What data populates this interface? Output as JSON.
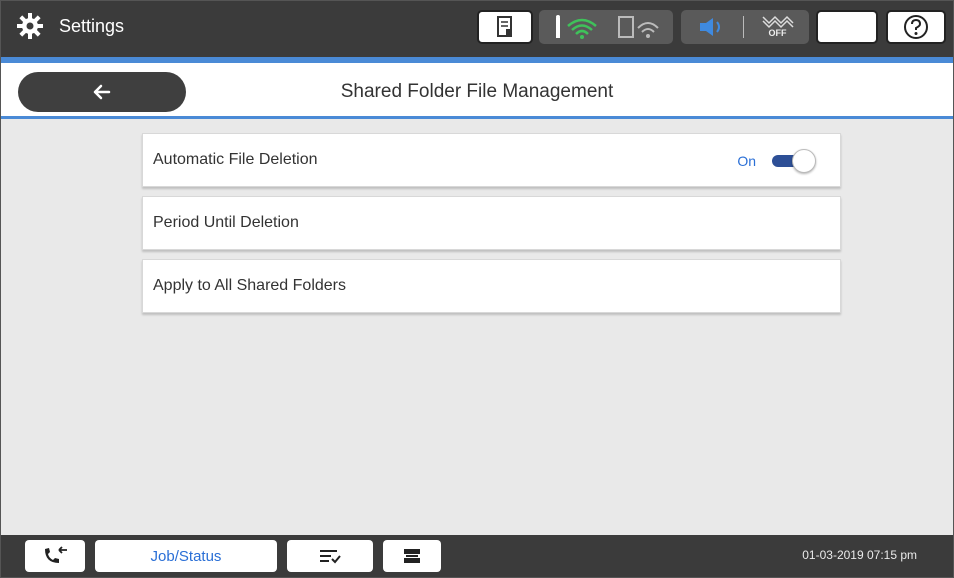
{
  "statusbar": {
    "title": "Settings",
    "icons": [
      "gear-icon",
      "printer-status-icon",
      "wifi-icon",
      "wifi-direct-icon",
      "sound-icon",
      "quiet-mode-icon",
      "sleep-icon",
      "help-icon"
    ],
    "quiet_label": "OFF"
  },
  "header": {
    "title": "Shared Folder File Management",
    "back_icon": "arrow-left-icon"
  },
  "settings": {
    "items": [
      {
        "label": "Automatic File Deletion",
        "value": "On",
        "toggle_on": true
      },
      {
        "label": "Period Until Deletion"
      },
      {
        "label": "Apply to All Shared Folders"
      }
    ]
  },
  "bottombar": {
    "job_status_label": "Job/Status",
    "datetime": "01-03-2019 07:15 pm"
  },
  "colors": {
    "accent": "#4a8ad6",
    "bar": "#3b3b3b",
    "link_blue": "#2a6fd6"
  }
}
